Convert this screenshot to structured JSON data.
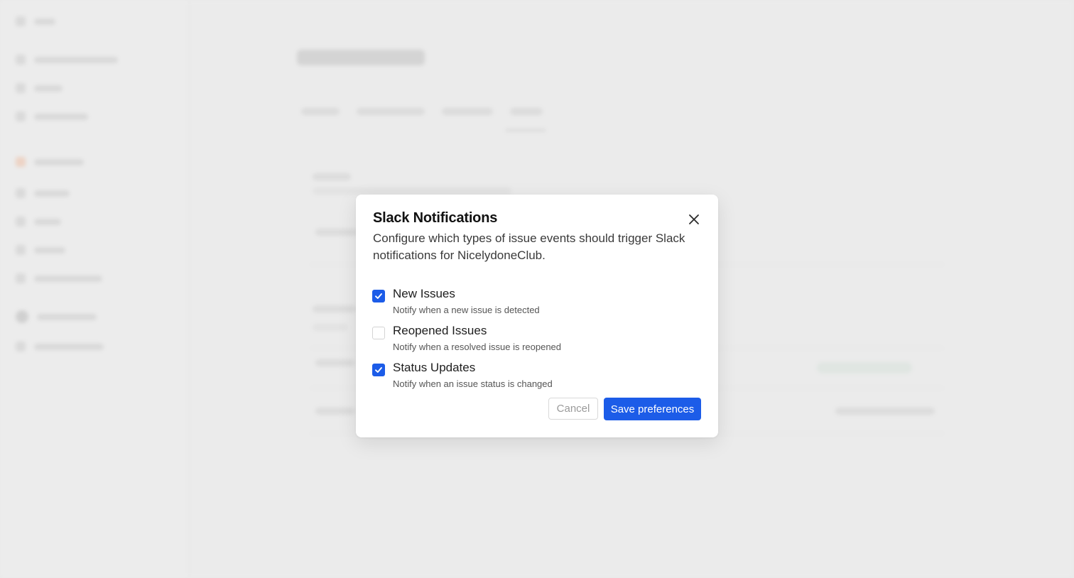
{
  "modal": {
    "title": "Slack Notifications",
    "description": "Configure which types of issue events should trigger Slack notifications for NicelydoneClub.",
    "close_icon": "close-icon",
    "options": [
      {
        "label": "New Issues",
        "help": "Notify when a new issue is detected",
        "checked": true
      },
      {
        "label": "Reopened Issues",
        "help": "Notify when a resolved issue is reopened",
        "checked": false
      },
      {
        "label": "Status Updates",
        "help": "Notify when an issue status is changed",
        "checked": true
      }
    ],
    "cancel_label": "Cancel",
    "save_label": "Save preferences"
  },
  "colors": {
    "accent": "#1c5ce8",
    "overlay": "#e9e9e9"
  }
}
